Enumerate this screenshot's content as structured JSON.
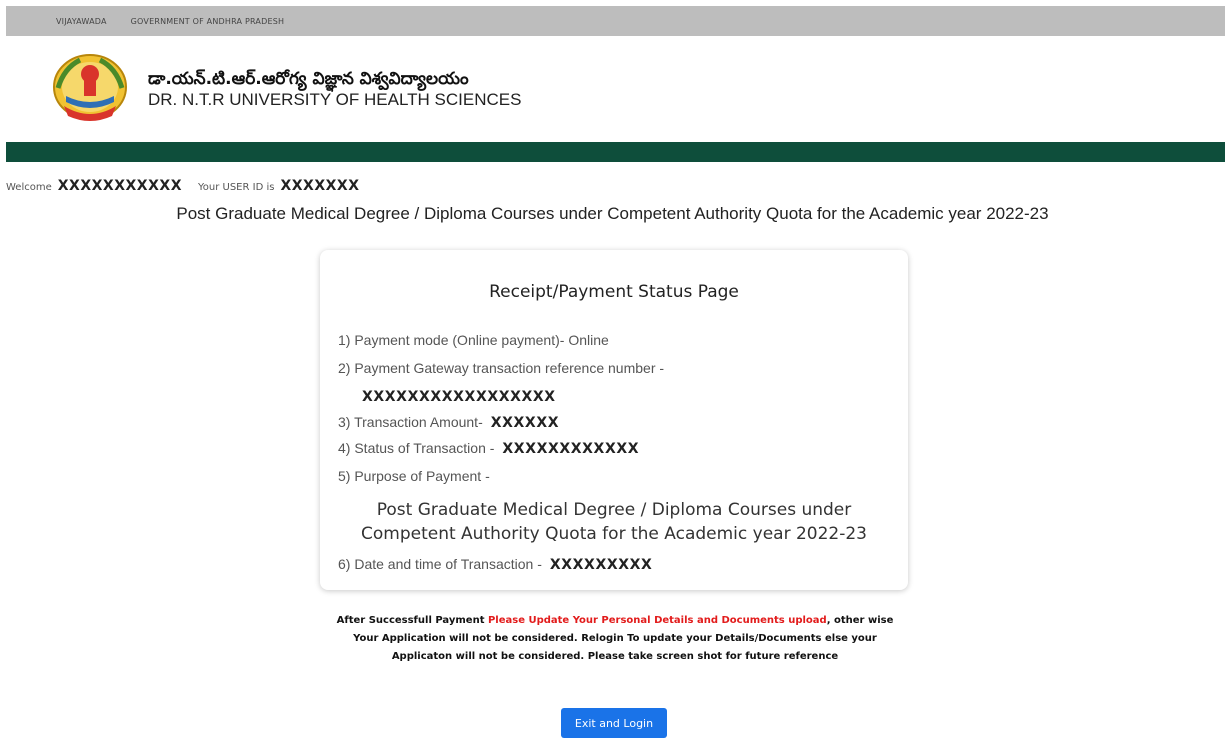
{
  "topbar": {
    "location": "VIJAYAWADA",
    "government": "GOVERNMENT OF ANDHRA PRADESH"
  },
  "header": {
    "university_telugu": "డా.యన్.టి.ఆర్.ఆరోగ్య విజ్ఞాన విశ్వవిద్యాలయం",
    "university_english": "DR. N.T.R UNIVERSITY OF HEALTH SCIENCES",
    "logo_icon": "university-seal-icon"
  },
  "welcome": {
    "welcome_label": "Welcome",
    "user_name": "XXXXXXXXXXX",
    "user_id_label": "Your USER ID is",
    "user_id": "XXXXXXX"
  },
  "page_heading": "Post Graduate Medical Degree / Diploma Courses under Competent Authority Quota for the Academic year 2022-23",
  "receipt": {
    "title": "Receipt/Payment Status Page",
    "payment_mode": "1) Payment mode (Online payment)- Online",
    "gateway_ref_label": "2) Payment Gateway transaction reference number -",
    "gateway_ref_value": "XXXXXXXXXXXXXXXXX",
    "amount_label": "3) Transaction Amount-",
    "amount_value": "XXXXXX",
    "status_label": "4) Status of Transaction -",
    "status_value": "XXXXXXXXXXXX",
    "purpose_label": "5) Purpose of Payment -",
    "purpose_line1": "Post Graduate Medical Degree / Diploma Courses under",
    "purpose_line2": "Competent Authority Quota for the Academic year 2022-23",
    "datetime_label": "6) Date and time of Transaction -",
    "datetime_value": "XXXXXXXXX"
  },
  "notice": {
    "prefix": "After Successfull Payment",
    "highlight": "Please Update Your Personal Details and Documents upload",
    "rest": ", other wise Your Application will not be considered. Relogin To update your Details/Documents else your Applicaton will not be considered. Please take screen shot for future reference"
  },
  "exit_button": "Exit and Login",
  "colors": {
    "topbar": "#bdbdbd",
    "green_bar": "#0e4e3b",
    "notice_red": "#e21b1b",
    "button_blue": "#1a73e8"
  }
}
